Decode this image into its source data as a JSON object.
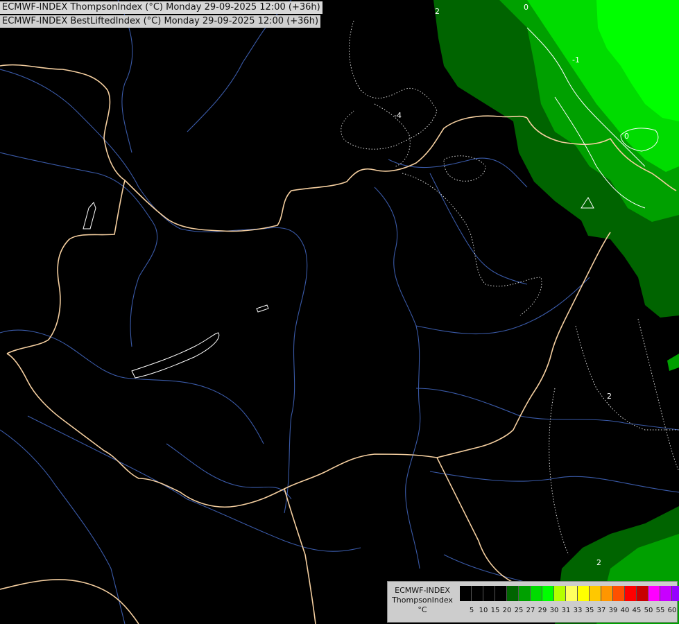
{
  "header": {
    "line1": "ECMWF-INDEX ThompsonIndex (°C) Monday 29-09-2025 12:00 (+36h)",
    "line2": "ECMWF-INDEX BestLiftedIndex (°C) Monday 29-09-2025 12:00 (+36h)"
  },
  "legend": {
    "line1": "ECMWF-INDEX",
    "line2": "ThompsonIndex",
    "unit": "°C",
    "colors": [
      "#000000",
      "#000000",
      "#000000",
      "#000000",
      "#006400",
      "#00a000",
      "#00dc00",
      "#00ff00",
      "#b4ff00",
      "#ffff60",
      "#ffff00",
      "#ffc800",
      "#ff9600",
      "#ff5000",
      "#ff0000",
      "#c80000",
      "#ff00ff",
      "#c800ff",
      "#9600ff",
      "#6400ff",
      "#0000ff"
    ],
    "ticks": [
      "5",
      "10",
      "15",
      "20",
      "25",
      "27",
      "29",
      "30",
      "31",
      "33",
      "35",
      "37",
      "39",
      "40",
      "45",
      "50",
      "55",
      "60"
    ]
  },
  "map_labels": {
    "contour_top_right_a": "0",
    "contour_top_right_b": "-1",
    "contour_top_center": "-4",
    "contour_left_upper": "2",
    "contour_right_mid": "2",
    "contour_bottom_right": "2",
    "contour_right_zero": "0"
  },
  "colors": {
    "dark_green": "#006400",
    "mid_green": "#00a000",
    "light_green": "#00dc00",
    "bright_green": "#00ff00",
    "border": "#f5cfa0",
    "river": "#3a5aa8",
    "contour": "#ffffff"
  }
}
